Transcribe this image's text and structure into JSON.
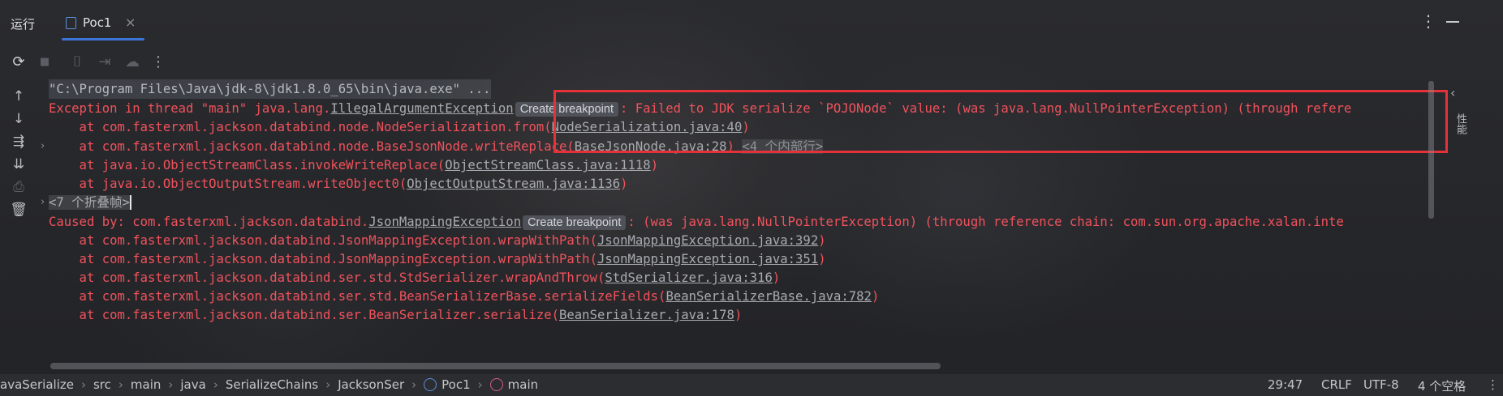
{
  "topbar": {
    "run_label": "运行",
    "tab_label": "Poc1",
    "tab_close": "×",
    "kebab": "⋮"
  },
  "toolbar": {
    "rerun": "⟳",
    "stop": "■",
    "camera": "⌷",
    "exit": "⇥",
    "cloud": "☁",
    "more": "⋮"
  },
  "left_rail": {
    "up": "↑",
    "down": "↓",
    "wrap": "⇶",
    "scroll_end": "⇊",
    "print": "⎙",
    "trash": "🗑"
  },
  "console": {
    "line1": "\"C:\\Program Files\\Java\\jdk-8\\jdk1.8.0_65\\bin\\java.exe\" ...",
    "line2_prefix": "Exception in thread \"main\" java.lang.",
    "line2_link": "IllegalArgumentException",
    "chip": "Create breakpoint",
    "line2_suffix": ": Failed to JDK serialize `POJONode` value: (was java.lang.NullPointerException) (through refere",
    "line3_prefix": "    at com.fasterxml.jackson.databind.node.NodeSerialization.from(",
    "line3_link": "NodeSerialization.java:40",
    "line3_suffix": ")",
    "line4_prefix": "    at com.fasterxml.jackson.databind.node.BaseJsonNode.writeReplace(",
    "line4_link": "BaseJsonNode.java:28",
    "line4_suffix": ")",
    "line4_fold": "<4 个内部行>",
    "line5_prefix": "    at java.io.ObjectStreamClass.invokeWriteReplace(",
    "line5_link": "ObjectStreamClass.java:1118",
    "line5_suffix": ")",
    "line6_prefix": "    at java.io.ObjectOutputStream.writeObject0(",
    "line6_link": "ObjectOutputStream.java:1136",
    "line6_suffix": ")",
    "line7_fold": "<7 个折叠帧>",
    "line8_prefix": "Caused by: com.fasterxml.jackson.databind.",
    "line8_link": "JsonMappingException",
    "line8_suffix": ": (was java.lang.NullPointerException) (through reference chain: com.sun.org.apache.xalan.inte",
    "line9_prefix": "    at com.fasterxml.jackson.databind.JsonMappingException.wrapWithPath(",
    "line9_link": "JsonMappingException.java:392",
    "line9_suffix": ")",
    "line10_prefix": "    at com.fasterxml.jackson.databind.JsonMappingException.wrapWithPath(",
    "line10_link": "JsonMappingException.java:351",
    "line10_suffix": ")",
    "line11_prefix": "    at com.fasterxml.jackson.databind.ser.std.StdSerializer.wrapAndThrow(",
    "line11_link": "StdSerializer.java:316",
    "line11_suffix": ")",
    "line12_prefix": "    at com.fasterxml.jackson.databind.ser.std.BeanSerializerBase.serializeFields(",
    "line12_link": "BeanSerializerBase.java:782",
    "line12_suffix": ")",
    "line13_prefix": "    at com.fasterxml.jackson.databind.ser.BeanSerializer.serialize(",
    "line13_link": "BeanSerializer.java:178",
    "line13_suffix": ")"
  },
  "right_rail": {
    "collapse": "‹",
    "label": "性能"
  },
  "statusbar": {
    "crumbs": [
      "avaSerialize",
      "src",
      "main",
      "java",
      "SerializeChains",
      "JacksonSer",
      "Poc1",
      "main"
    ],
    "separator": "›",
    "position": "29:47",
    "line_ending": "CRLF",
    "encoding": "UTF-8",
    "indent": "4 个空格",
    "more": "⋮"
  },
  "colors": {
    "error": "#f0525c",
    "accent": "#3d74d6",
    "highlight_box": "#e3323a"
  }
}
